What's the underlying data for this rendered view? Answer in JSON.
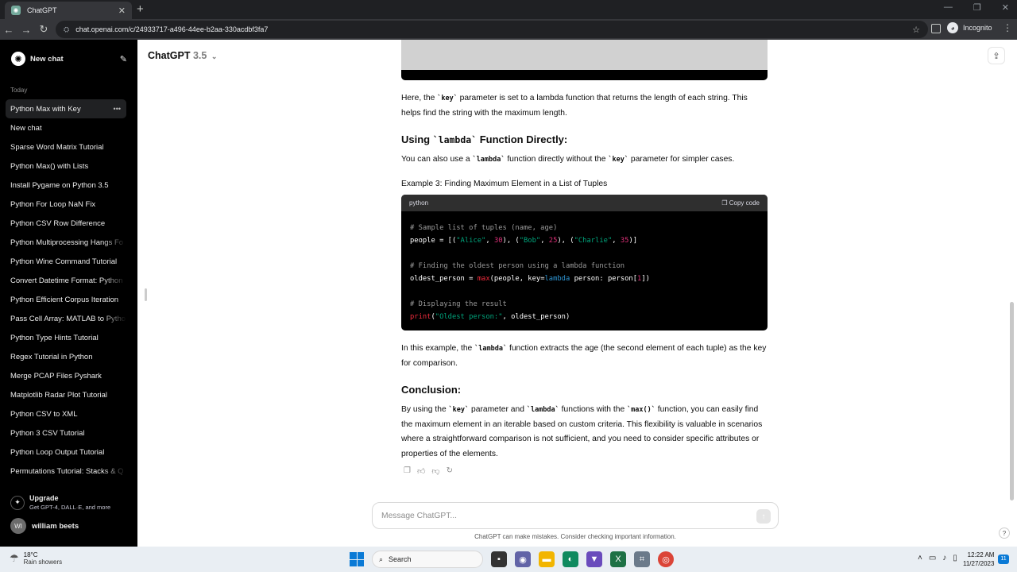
{
  "browser": {
    "tab_title": "ChatGPT",
    "url": "chat.openai.com/c/24933717-a496-44ee-b2aa-330acdbf3fa7",
    "incognito_label": "Incognito"
  },
  "sidebar": {
    "new_chat_label": "New chat",
    "section_label": "Today",
    "items": [
      {
        "label": "Python Max with Key"
      },
      {
        "label": "New chat"
      },
      {
        "label": "Sparse Word Matrix Tutorial"
      },
      {
        "label": "Python Max() with Lists"
      },
      {
        "label": "Install Pygame on Python 3.5"
      },
      {
        "label": "Python For Loop NaN Fix"
      },
      {
        "label": "Python CSV Row Difference"
      },
      {
        "label": "Python Multiprocessing Hangs Fo"
      },
      {
        "label": "Python Wine Command Tutorial"
      },
      {
        "label": "Convert Datetime Format: Python"
      },
      {
        "label": "Python Efficient Corpus Iteration"
      },
      {
        "label": "Pass Cell Array: MATLAB to Pytho"
      },
      {
        "label": "Python Type Hints Tutorial"
      },
      {
        "label": "Regex Tutorial in Python"
      },
      {
        "label": "Merge PCAP Files Pyshark"
      },
      {
        "label": "Matplotlib Radar Plot Tutorial"
      },
      {
        "label": "Python CSV to XML"
      },
      {
        "label": "Python 3 CSV Tutorial"
      },
      {
        "label": "Python Loop Output Tutorial"
      },
      {
        "label": "Permutations Tutorial: Stacks & Q"
      }
    ],
    "upgrade_title": "Upgrade",
    "upgrade_subtitle": "Get GPT-4, DALL·E, and more",
    "user_initials": "WI",
    "user_name": "william beets"
  },
  "header": {
    "model_name": "ChatGPT",
    "model_version": "3.5"
  },
  "message": {
    "p1_a": "Here, the ",
    "p1_code": "`key`",
    "p1_b": " parameter is set to a lambda function that returns the length of each string. This helps find the string with the maximum length.",
    "h_using_a": "Using ",
    "h_using_code": "`lambda`",
    "h_using_b": " Function Directly:",
    "p2_a": "You can also use a ",
    "p2_code1": "`lambda`",
    "p2_b": " function directly without the ",
    "p2_code2": "`key`",
    "p2_c": " parameter for simpler cases.",
    "example_title": "Example 3: Finding Maximum Element in a List of Tuples",
    "code_lang": "python",
    "copy_label": "Copy code",
    "code": {
      "l1": "# Sample list of tuples (name, age)",
      "l2_a": "people = [(",
      "l2_s1": "\"Alice\"",
      "l2_c1": ", ",
      "l2_n1": "30",
      "l2_b": "), (",
      "l2_s2": "\"Bob\"",
      "l2_c2": ", ",
      "l2_n2": "25",
      "l2_c": "), (",
      "l2_s3": "\"Charlie\"",
      "l2_c3": ", ",
      "l2_n3": "35",
      "l2_d": ")]",
      "l3": "# Finding the oldest person using a lambda function",
      "l4_a": "oldest_person = ",
      "l4_fn": "max",
      "l4_b": "(people, key=",
      "l4_kw": "lambda",
      "l4_c": " person: person[",
      "l4_n": "1",
      "l4_d": "])",
      "l5": "# Displaying the result",
      "l6_fn": "print",
      "l6_a": "(",
      "l6_s": "\"Oldest person:\"",
      "l6_b": ", oldest_person)"
    },
    "p3_a": "In this example, the ",
    "p3_code": "`lambda`",
    "p3_b": " function extracts the age (the second element of each tuple) as the key for comparison.",
    "h_conclusion": "Conclusion:",
    "p4_a": "By using the ",
    "p4_code1": "`key`",
    "p4_b": " parameter and ",
    "p4_code2": "`lambda`",
    "p4_c": " functions with the ",
    "p4_code3": "`max()`",
    "p4_d": " function, you can easily find the maximum element in an iterable based on custom criteria. This flexibility is valuable in scenarios where a straightforward comparison is not sufficient, and you need to consider specific attributes or properties of the elements."
  },
  "composer": {
    "placeholder": "Message ChatGPT...",
    "disclaimer": "ChatGPT can make mistakes. Consider checking important information."
  },
  "taskbar": {
    "temperature": "18°C",
    "weather": "Rain showers",
    "search_label": "Search",
    "time": "12:22 AM",
    "date": "11/27/2023",
    "notif_count": "11"
  },
  "colors": {
    "sidebar_bg": "#000000",
    "code_string": "#00a67d",
    "code_number": "#df3079",
    "code_keyword": "#2e95d3"
  }
}
